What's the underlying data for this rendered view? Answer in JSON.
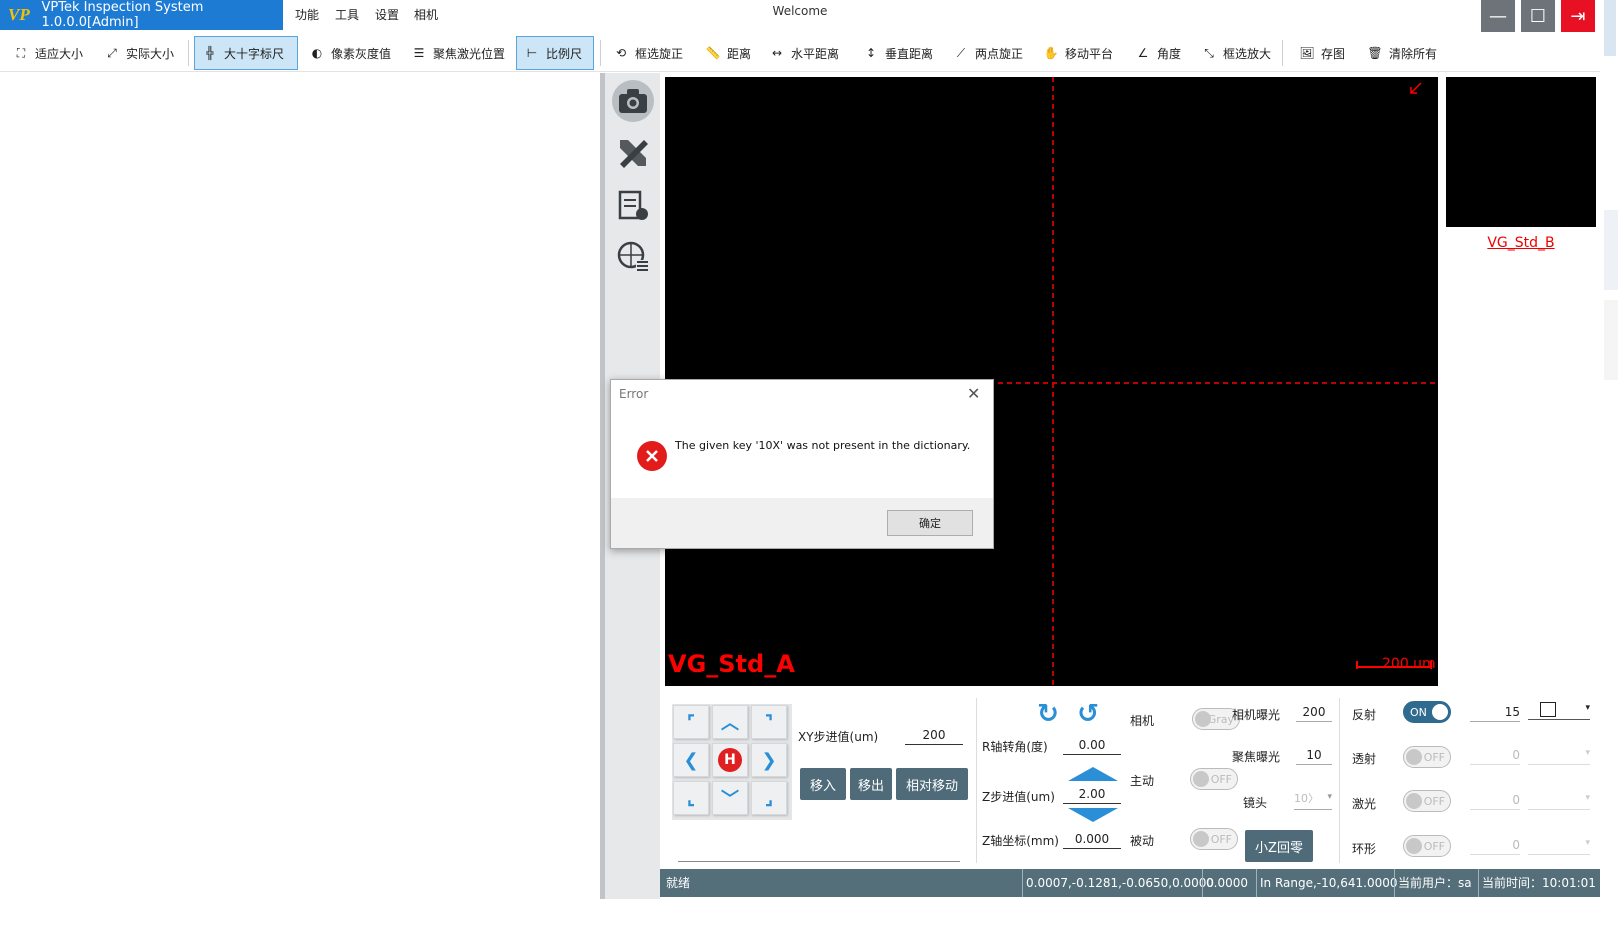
{
  "app": {
    "title": "VPTek Inspection System 1.0.0.0[Admin]",
    "logo": "VP",
    "window_title": "Welcome"
  },
  "menu": [
    "功能",
    "工具",
    "设置",
    "相机"
  ],
  "toolbar": [
    {
      "label": "适应大小",
      "icon": "fit-size-icon",
      "active": false
    },
    {
      "label": "实际大小",
      "icon": "actual-size-icon",
      "active": false
    },
    {
      "label": "大十字标尺",
      "icon": "crosshair-ruler-icon",
      "active": true
    },
    {
      "label": "像素灰度值",
      "icon": "pixel-gray-icon",
      "active": false
    },
    {
      "label": "聚焦激光位置",
      "icon": "focus-laser-icon",
      "active": false
    },
    {
      "label": "比例尺",
      "icon": "scale-ruler-icon",
      "active": true
    },
    {
      "label": "框选旋正",
      "icon": "box-rotate-icon",
      "active": false
    },
    {
      "label": "距离",
      "icon": "distance-ruler-icon",
      "active": false
    },
    {
      "label": "水平距离",
      "icon": "horizontal-distance-icon",
      "active": false
    },
    {
      "label": "垂直距离",
      "icon": "vertical-distance-icon",
      "active": false
    },
    {
      "label": "两点旋正",
      "icon": "two-point-rotate-icon",
      "active": false
    },
    {
      "label": "移动平台",
      "icon": "move-stage-icon",
      "active": false
    },
    {
      "label": "角度",
      "icon": "angle-icon",
      "active": false
    },
    {
      "label": "框选放大",
      "icon": "box-zoom-icon",
      "active": false
    },
    {
      "label": "存图",
      "icon": "save-image-icon",
      "active": false
    },
    {
      "label": "清除所有",
      "icon": "clear-all-icon",
      "active": false
    }
  ],
  "side_icons": [
    "camera-icon",
    "tools-icon",
    "report-icon",
    "grid-list-icon"
  ],
  "camera": {
    "main_label": "VG_Std_A",
    "thumb_label": "VG_Std_B",
    "scale": "200 um"
  },
  "jog": {
    "home": "H"
  },
  "xy": {
    "label": "XY步进值(um)",
    "value": "200"
  },
  "move_buttons": {
    "in": "移入",
    "out": "移出",
    "relative": "相对移动"
  },
  "r_axis": {
    "label": "R轴转角(度)",
    "value": "0.00"
  },
  "z_step": {
    "label": "Z步进值(um)",
    "value": "2.00"
  },
  "z_coord": {
    "label": "Z轴坐标(mm)",
    "value": "0.000"
  },
  "camera_ctrl": {
    "label": "相机",
    "toggle": "Gray",
    "exposure_label": "相机曝光",
    "exposure_value": "200"
  },
  "active_ctrl": {
    "label": "主动",
    "toggle": "OFF",
    "focus_label": "聚焦曝光",
    "focus_value": "10"
  },
  "lens": {
    "label": "镜头",
    "value": "10〉"
  },
  "passive_ctrl": {
    "label": "被动",
    "toggle": "OFF",
    "button": "小Z回零"
  },
  "lights": [
    {
      "label": "反射",
      "toggle": "ON",
      "value": "15",
      "on": true
    },
    {
      "label": "透射",
      "toggle": "OFF",
      "value": "0",
      "on": false
    },
    {
      "label": "激光",
      "toggle": "OFF",
      "value": "0",
      "on": false
    },
    {
      "label": "环形",
      "toggle": "OFF",
      "value": "0",
      "on": false
    }
  ],
  "status": {
    "state": "就绪",
    "coords": "0.0007,-0.1281,-0.0650,0.0000",
    "z": "0.0000",
    "range": "In Range,-10,641.0000",
    "user": "当前用户：sa",
    "time": "当前时间：10:01:01"
  },
  "dialog": {
    "title": "Error",
    "message": "The given key '10X' was not present in the dictionary.",
    "ok": "确定"
  },
  "colors": {
    "title_blue": "#1e7bd4",
    "status_bar": "#546e7a",
    "crosshair": "#ff0000",
    "close_red": "#e81123"
  }
}
